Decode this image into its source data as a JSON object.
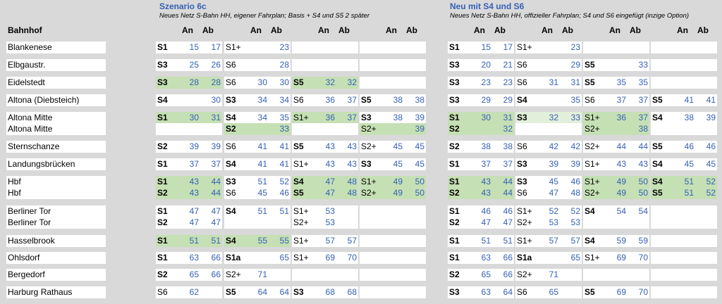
{
  "header": {
    "bahnhof_label": "Bahnhof",
    "left_title": "Szenario 6c",
    "left_subtitle": "Neues Netz S-Bahn HH, eigener Fahrplan; Basis + S4 und S5 2 später",
    "right_title": "Neu mit S4 und S6",
    "right_subtitle": "Neues Netz S-Bahn HH, offizieller Fahrplan; S4 und S6 eingefügt (inzige Option)",
    "an": "An",
    "ab": "Ab"
  },
  "colors": {
    "green": "#c5e0b4",
    "light_green": "#e2efda",
    "blue_text": "#3560b6"
  },
  "rows": [
    {
      "station": "Blankenese",
      "left": [
        [
          "S1",
          "15",
          "17",
          0
        ],
        [
          "S1+",
          "",
          "23",
          0
        ],
        [
          "",
          "",
          "",
          0
        ],
        [
          "",
          "",
          "",
          0
        ]
      ],
      "right": [
        [
          "S1",
          "15",
          "17",
          0
        ],
        [
          "S1+",
          "",
          "23",
          0
        ],
        [
          "",
          "",
          "",
          0
        ],
        [
          "",
          "",
          "",
          0
        ]
      ]
    },
    {
      "station": "Elbgaustr.",
      "left": [
        [
          "S3",
          "25",
          "26",
          0
        ],
        [
          "S6",
          "",
          "28",
          0
        ],
        [
          "",
          "",
          "",
          0
        ],
        [
          "",
          "",
          "",
          0
        ]
      ],
      "right": [
        [
          "S3",
          "20",
          "21",
          0
        ],
        [
          "S6",
          "",
          "29",
          0
        ],
        [
          "S5",
          "",
          "33",
          0
        ],
        [
          "",
          "",
          "",
          0
        ]
      ]
    },
    {
      "station": "Eidelstedt",
      "left": [
        [
          "S3",
          "28",
          "28",
          1
        ],
        [
          "S6",
          "30",
          "30",
          0
        ],
        [
          "S5",
          "32",
          "32",
          1
        ],
        [
          "",
          "",
          "",
          0
        ]
      ],
      "right": [
        [
          "S3",
          "23",
          "23",
          0
        ],
        [
          "S6",
          "31",
          "31",
          0
        ],
        [
          "S5",
          "35",
          "35",
          0
        ],
        [
          "",
          "",
          "",
          0
        ]
      ]
    },
    {
      "station": "Altona (Diebsteich)",
      "left": [
        [
          "S4",
          "",
          "30",
          0
        ],
        [
          "S3",
          "34",
          "34",
          0
        ],
        [
          "S6",
          "36",
          "37",
          0
        ],
        [
          "S5",
          "38",
          "38",
          0
        ]
      ],
      "right": [
        [
          "S3",
          "29",
          "29",
          0
        ],
        [
          "S4",
          "",
          "35",
          0
        ],
        [
          "S6",
          "37",
          "37",
          0
        ],
        [
          "S5",
          "41",
          "41",
          0
        ]
      ]
    },
    {
      "station": "Altona Mitte",
      "left": [
        [
          "S1",
          "30",
          "31",
          1
        ],
        [
          "S4",
          "34",
          "35",
          0
        ],
        [
          "S1+",
          "36",
          "37",
          1
        ],
        [
          "S3",
          "38",
          "39",
          0
        ]
      ],
      "right": [
        [
          "S1",
          "30",
          "31",
          1
        ],
        [
          "S3",
          "32",
          "33",
          2
        ],
        [
          "S1+",
          "36",
          "37",
          1
        ],
        [
          "S4",
          "38",
          "39",
          0
        ]
      ]
    },
    {
      "station": "Altona Mitte",
      "left": [
        [
          "",
          "",
          "",
          0
        ],
        [
          "S2",
          "",
          "33",
          1
        ],
        [
          "",
          "",
          "",
          0
        ],
        [
          "S2+",
          "",
          "39",
          1
        ]
      ],
      "right": [
        [
          "S2",
          "",
          "32",
          1
        ],
        [
          "",
          "",
          "",
          0
        ],
        [
          "S2+",
          "",
          "38",
          1
        ],
        [
          "",
          "",
          "",
          0
        ]
      ]
    },
    {
      "station": "Sternschanze",
      "left": [
        [
          "S2",
          "39",
          "39",
          0
        ],
        [
          "S6",
          "41",
          "41",
          0
        ],
        [
          "S5",
          "43",
          "43",
          0
        ],
        [
          "S2+",
          "45",
          "45",
          0
        ]
      ],
      "right": [
        [
          "S2",
          "38",
          "38",
          0
        ],
        [
          "S6",
          "42",
          "42",
          0
        ],
        [
          "S2+",
          "44",
          "44",
          0
        ],
        [
          "S5",
          "46",
          "46",
          0
        ]
      ]
    },
    {
      "station": "Landungsbrücken",
      "left": [
        [
          "S1",
          "37",
          "37",
          0
        ],
        [
          "S4",
          "41",
          "41",
          0
        ],
        [
          "S1+",
          "43",
          "43",
          0
        ],
        [
          "S3",
          "45",
          "45",
          0
        ]
      ],
      "right": [
        [
          "S1",
          "37",
          "37",
          0
        ],
        [
          "S3",
          "39",
          "39",
          0
        ],
        [
          "S1+",
          "43",
          "43",
          0
        ],
        [
          "S4",
          "45",
          "45",
          0
        ]
      ]
    },
    {
      "station": "Hbf",
      "left": [
        [
          "S1",
          "43",
          "44",
          1
        ],
        [
          "S3",
          "51",
          "52",
          0
        ],
        [
          "S4",
          "47",
          "48",
          1
        ],
        [
          "S1+",
          "49",
          "50",
          1
        ]
      ],
      "right": [
        [
          "S1",
          "43",
          "44",
          1
        ],
        [
          "S3",
          "45",
          "46",
          0
        ],
        [
          "S1+",
          "49",
          "50",
          1
        ],
        [
          "S4",
          "51",
          "52",
          1
        ]
      ]
    },
    {
      "station": "Hbf",
      "left": [
        [
          "S2",
          "43",
          "44",
          1
        ],
        [
          "S6",
          "45",
          "46",
          0
        ],
        [
          "S5",
          "47",
          "48",
          1
        ],
        [
          "S2+",
          "49",
          "50",
          1
        ]
      ],
      "right": [
        [
          "S2",
          "43",
          "44",
          1
        ],
        [
          "S6",
          "47",
          "48",
          0
        ],
        [
          "S2+",
          "49",
          "50",
          1
        ],
        [
          "S5",
          "51",
          "52",
          1
        ]
      ]
    },
    {
      "station": "Berliner Tor",
      "left": [
        [
          "S1",
          "47",
          "47",
          0
        ],
        [
          "S4",
          "51",
          "51",
          0
        ],
        [
          "S1+",
          "53",
          "",
          0
        ],
        [
          "",
          "",
          "",
          0
        ]
      ],
      "right": [
        [
          "S1",
          "46",
          "46",
          0
        ],
        [
          "S1+",
          "52",
          "52",
          0
        ],
        [
          "S4",
          "54",
          "54",
          0
        ],
        [
          "",
          "",
          "",
          0
        ]
      ]
    },
    {
      "station": "Berliner Tor",
      "left": [
        [
          "S2",
          "47",
          "47",
          0
        ],
        [
          "",
          "",
          "",
          0
        ],
        [
          "S2+",
          "53",
          "",
          0
        ],
        [
          "",
          "",
          "",
          0
        ]
      ],
      "right": [
        [
          "S2",
          "47",
          "47",
          0
        ],
        [
          "S2+",
          "53",
          "53",
          0
        ],
        [
          "",
          "",
          "",
          0
        ],
        [
          "",
          "",
          "",
          0
        ]
      ]
    },
    {
      "station": "Hasselbrook",
      "left": [
        [
          "S1",
          "51",
          "51",
          1
        ],
        [
          "S4",
          "55",
          "55",
          1
        ],
        [
          "S1+",
          "57",
          "57",
          0
        ],
        [
          "",
          "",
          "",
          0
        ]
      ],
      "right": [
        [
          "S1",
          "51",
          "51",
          0
        ],
        [
          "S1+",
          "57",
          "57",
          0
        ],
        [
          "S4",
          "59",
          "59",
          0
        ],
        [
          "",
          "",
          "",
          0
        ]
      ]
    },
    {
      "station": "Ohlsdorf",
      "left": [
        [
          "S1",
          "63",
          "66",
          0
        ],
        [
          "S1a",
          "",
          "65",
          0
        ],
        [
          "S1+",
          "69",
          "70",
          0
        ],
        [
          "",
          "",
          "",
          0
        ]
      ],
      "right": [
        [
          "S1",
          "63",
          "66",
          0
        ],
        [
          "S1a",
          "",
          "65",
          0
        ],
        [
          "S1+",
          "69",
          "70",
          0
        ],
        [
          "",
          "",
          "",
          0
        ]
      ]
    },
    {
      "station": "Bergedorf",
      "left": [
        [
          "S2",
          "65",
          "66",
          0
        ],
        [
          "S2+",
          "71",
          "",
          0
        ],
        [
          "",
          "",
          "",
          0
        ],
        [
          "",
          "",
          "",
          0
        ]
      ],
      "right": [
        [
          "S2",
          "65",
          "66",
          0
        ],
        [
          "S2+",
          "71",
          "",
          0
        ],
        [
          "",
          "",
          "",
          0
        ],
        [
          "",
          "",
          "",
          0
        ]
      ]
    },
    {
      "station": "Harburg Rathaus",
      "left": [
        [
          "S6",
          "62",
          "",
          0
        ],
        [
          "S5",
          "64",
          "64",
          0
        ],
        [
          "S3",
          "68",
          "68",
          0
        ],
        [
          "",
          "",
          "",
          0
        ]
      ],
      "right": [
        [
          "S3",
          "63",
          "64",
          0
        ],
        [
          "S6",
          "65",
          "",
          0
        ],
        [
          "S5",
          "69",
          "70",
          0
        ],
        [
          "",
          "",
          "",
          0
        ]
      ]
    }
  ]
}
